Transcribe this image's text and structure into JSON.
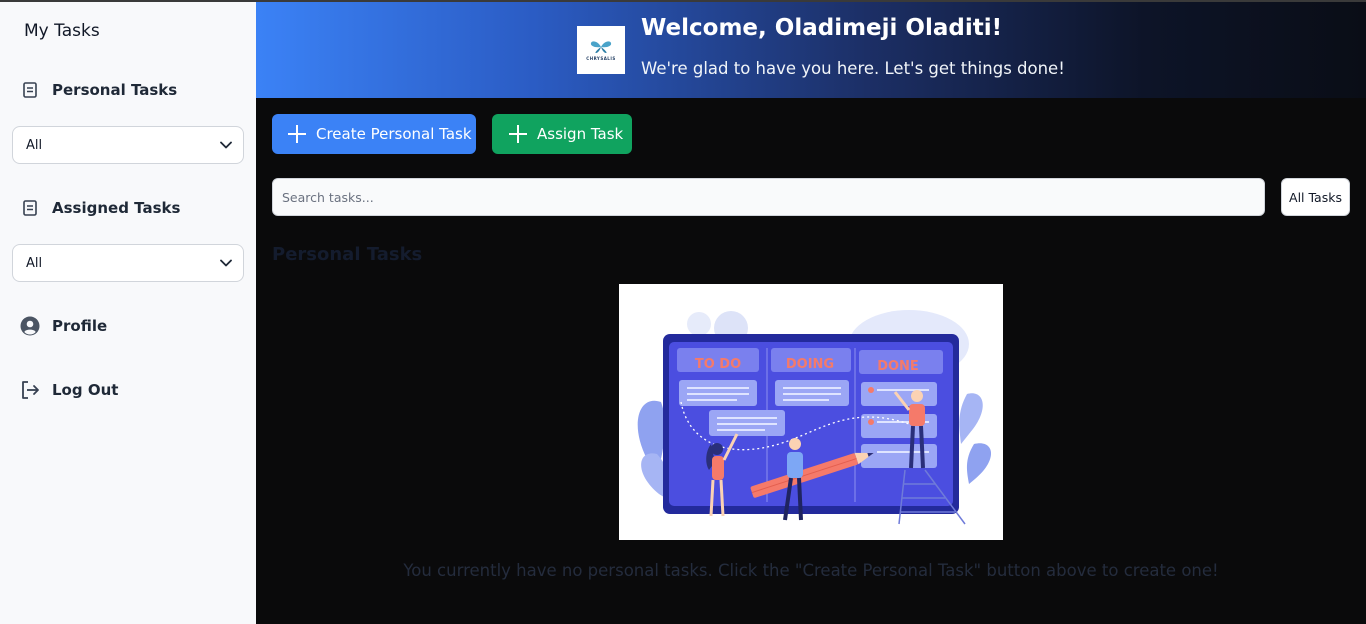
{
  "sidebar": {
    "title": "My Tasks",
    "personal": {
      "label": "Personal Tasks",
      "icon": "list-icon",
      "filter_value": "All"
    },
    "assigned": {
      "label": "Assigned Tasks",
      "icon": "list-icon",
      "filter_value": "All"
    },
    "profile": {
      "label": "Profile",
      "icon": "user-circle-icon"
    },
    "logout": {
      "label": "Log Out",
      "icon": "logout-icon"
    }
  },
  "header": {
    "logo_text": "CHRYSALIS",
    "welcome": "Welcome, Oladimeji Oladiti!",
    "subtitle": "We're glad to have you here. Let's get things done!"
  },
  "actions": {
    "create_label": "Create Personal Task",
    "assign_label": "Assign Task"
  },
  "search": {
    "placeholder": "Search tasks...",
    "value": ""
  },
  "filter": {
    "label": "All Tasks"
  },
  "main": {
    "section_title": "Personal Tasks",
    "illustration": {
      "col1": "TO DO",
      "col2": "DOING",
      "col3": "DONE"
    },
    "empty_message": "You currently have no personal tasks. Click the \"Create Personal Task\" button above to create one!"
  },
  "colors": {
    "primary": "#3b82f6",
    "success": "#10a35f",
    "sidebar_bg": "#f8f9fb",
    "main_bg": "#0a0a0b"
  }
}
